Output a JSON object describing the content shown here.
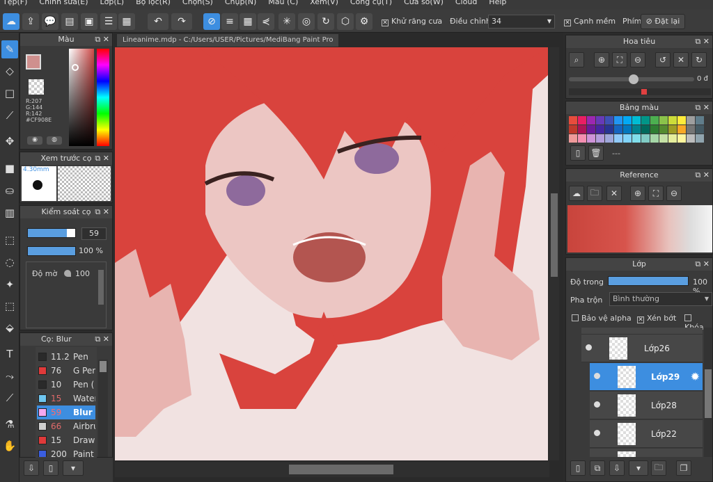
{
  "menu": [
    "Tệp(F)",
    "Chỉnh sửa(E)",
    "Lớp(L)",
    "Bộ lọc(R)",
    "Chọn(S)",
    "Chụp(N)",
    "Màu (C)",
    "Xem(V)",
    "Công cụ(T)",
    "Cửa sổ(W)",
    "Cloud",
    "Help"
  ],
  "toolbar": {
    "antialias_label": "Khử răng cưa",
    "adjust_label": "Điều chỉnh",
    "adjust_value": "34",
    "soft_edge_label": "Cạnh mềm",
    "key_label": "Phím",
    "reset_label": "Đặt lại"
  },
  "color_panel": {
    "title": "Màu",
    "r": "R:207",
    "g": "G:144",
    "b": "R:142",
    "hex": "#CF908E",
    "fg_color": "#cf908e"
  },
  "preview_panel": {
    "title": "Xem trước cọ",
    "size": "4.30mm"
  },
  "brush_control": {
    "title": "Kiểm soát cọ",
    "size_value": "59",
    "opacity_value": "100 %",
    "blur_label": "Độ mờ",
    "blur_value": "100"
  },
  "brush_list": {
    "title": "Cọ: Blur",
    "items": [
      {
        "size": "11.2",
        "name": "Pen",
        "color": "#2a2a2a"
      },
      {
        "size": "76",
        "name": "G Pen",
        "color": "#e03a3a"
      },
      {
        "size": "10",
        "name": "Pen (",
        "color": "#2a2a2a"
      },
      {
        "size": "15",
        "name": "Water",
        "color": "#6ec6f0"
      },
      {
        "size": "59",
        "name": "Blur",
        "color": "#f4a8f0"
      },
      {
        "size": "66",
        "name": "Airbru",
        "color": "#cfcfcf"
      },
      {
        "size": "15",
        "name": "Drawi",
        "color": "#e03a3a"
      },
      {
        "size": "200",
        "name": "Paint",
        "color": "#3a5ee0"
      }
    ]
  },
  "document": {
    "tab_title": "Lineanime.mdp - C:/Users/USER/Pictures/MediBang Paint Pro"
  },
  "navigator": {
    "title": "Hoa tiêu",
    "zoom_text": "0 đ"
  },
  "palette": {
    "title": "Bảng màu",
    "footer": "---",
    "colors": [
      "#e74c3c",
      "#e91e63",
      "#9c27b0",
      "#673ab7",
      "#3f51b5",
      "#2196f3",
      "#03a9f4",
      "#00bcd4",
      "#009688",
      "#4caf50",
      "#8bc34a",
      "#cddc39",
      "#ffeb3b",
      "#9e9e9e",
      "#607d8b",
      "#c0392b",
      "#ad1457",
      "#6a1b9a",
      "#4527a0",
      "#283593",
      "#1565c0",
      "#0277bd",
      "#00838f",
      "#00695c",
      "#2e7d32",
      "#558b2f",
      "#9e9d24",
      "#f9a825",
      "#757575",
      "#455a64",
      "#ef9a9a",
      "#f48fb1",
      "#ce93d8",
      "#b39ddb",
      "#9fa8da",
      "#90caf9",
      "#81d4fa",
      "#80deea",
      "#80cbc4",
      "#a5d6a7",
      "#c5e1a5",
      "#e6ee9c",
      "#fff59d",
      "#bdbdbd",
      "#90a4ae"
    ]
  },
  "reference": {
    "title": "Reference"
  },
  "layers": {
    "title": "Lớp",
    "opacity_label": "Độ trong",
    "opacity_value": "100 %",
    "blend_label": "Pha trộn",
    "blend_value": "Bình thường",
    "protect_alpha": "Bảo vệ alpha",
    "clipping": "Xén bớt",
    "lock": "Khóa",
    "items": [
      "Lớp26",
      "Lớp29",
      "Lớp28",
      "Lớp22"
    ]
  }
}
